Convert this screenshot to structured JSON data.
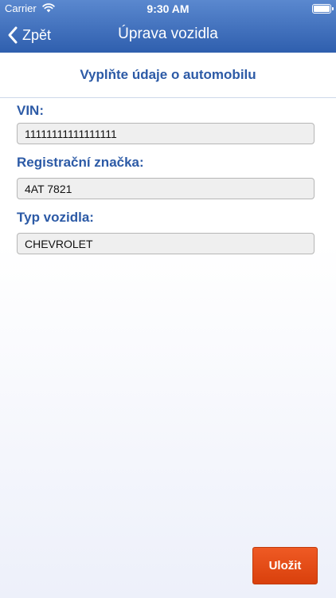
{
  "status_bar": {
    "carrier": "Carrier",
    "time": "9:30 AM"
  },
  "nav": {
    "back_label": "Zpět",
    "title": "Úprava vozidla"
  },
  "form": {
    "heading": "Vyplňte údaje o automobilu",
    "fields": [
      {
        "label": "VIN:",
        "value": "11111111111111111"
      },
      {
        "label": "Registrační značka:",
        "value": "4AT 7821"
      },
      {
        "label": "Typ vozidla:",
        "value": "CHEVROLET"
      }
    ],
    "save_label": "Uložit"
  },
  "colors": {
    "nav_blue": "#2f5fae",
    "heading_blue": "#2c5aa6",
    "save_orange": "#e64a17"
  },
  "icons": [
    "wifi-icon",
    "battery-icon",
    "chevron-left-icon"
  ]
}
